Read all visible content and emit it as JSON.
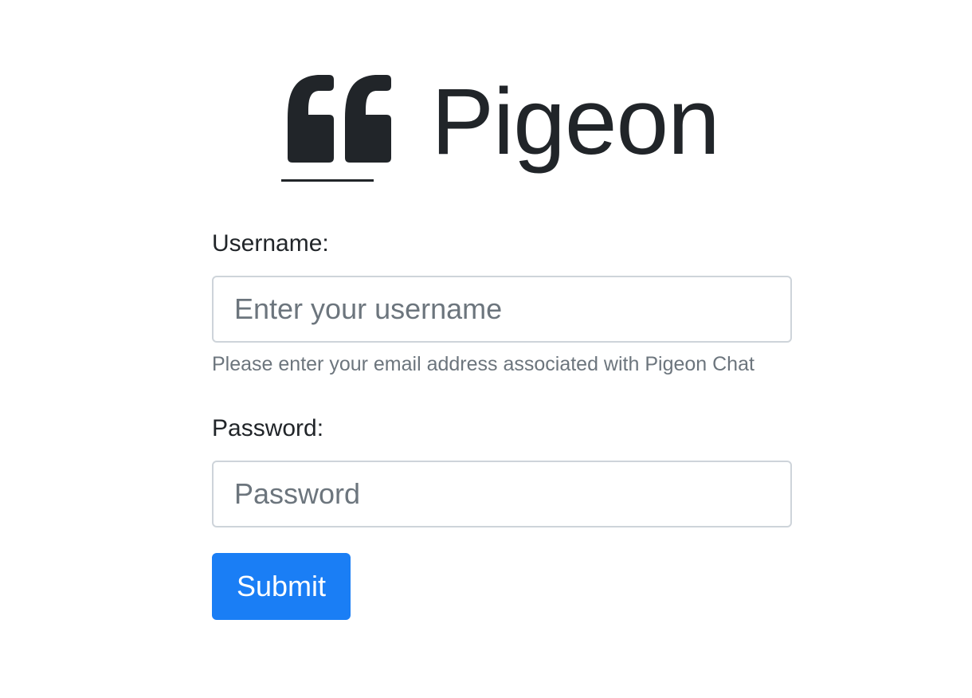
{
  "brand": {
    "icon": "quote-left-icon",
    "name": "Pigeon",
    "color": "#212529"
  },
  "form": {
    "username": {
      "label": "Username:",
      "placeholder": "Enter your username",
      "value": "",
      "help": "Please enter your email address associated with Pigeon Chat"
    },
    "password": {
      "label": "Password:",
      "placeholder": "Password",
      "value": ""
    },
    "submit_label": "Submit",
    "accent_color": "#1a7ef5"
  }
}
